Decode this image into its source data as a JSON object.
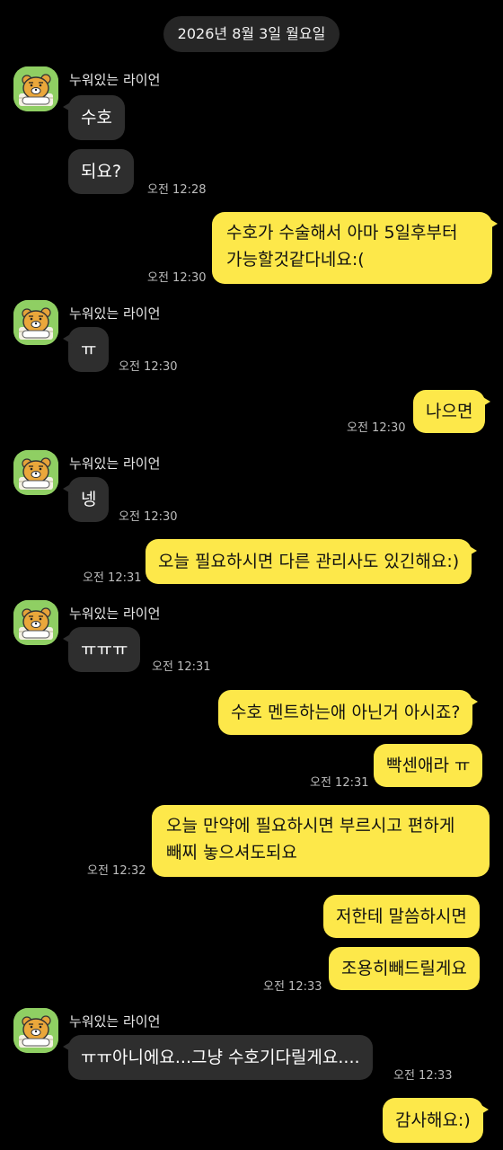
{
  "date_divider": "2026년 8월 3일 월요일",
  "sender_name": "누워있는 라이언",
  "avatar_icon": "ryan-lying-avatar-icon",
  "colors": {
    "background": "#000000",
    "incoming_bubble": "#2e2e2e",
    "outgoing_bubble": "#fde84a",
    "timestamp": "#bdbdbd"
  },
  "messages": [
    {
      "text": "수호"
    },
    {
      "text": "되요?",
      "time": "오전 12:28"
    },
    {
      "text": "수호가 수술해서 아마 5일후부터 가능할것같다네요:(",
      "time": "오전 12:30"
    },
    {
      "text": "ㅠ",
      "time": "오전 12:30"
    },
    {
      "text": "나으면",
      "time": "오전 12:30"
    },
    {
      "text": "넹",
      "time": "오전 12:30"
    },
    {
      "text": "오늘 필요하시면 다른 관리사도 있긴해요:)",
      "time": "오전 12:31"
    },
    {
      "text": "ㅠㅠㅠ",
      "time": "오전 12:31"
    },
    {
      "text": "수호 멘트하는애 아닌거 아시죠?"
    },
    {
      "text": "빡센애라 ㅠ",
      "time": "오전 12:31"
    },
    {
      "text": "오늘 만약에 필요하시면 부르시고 편하게 빼찌 놓으셔도되요",
      "time": "오전 12:32"
    },
    {
      "text": "저한테 말씀하시면"
    },
    {
      "text": "조용히빼드릴게요",
      "time": "오전 12:33"
    },
    {
      "text": "ㅠㅠ아니에요...그냥 수호기다릴게요....",
      "time": "오전 12:33"
    },
    {
      "text": "감사해요:)"
    }
  ]
}
